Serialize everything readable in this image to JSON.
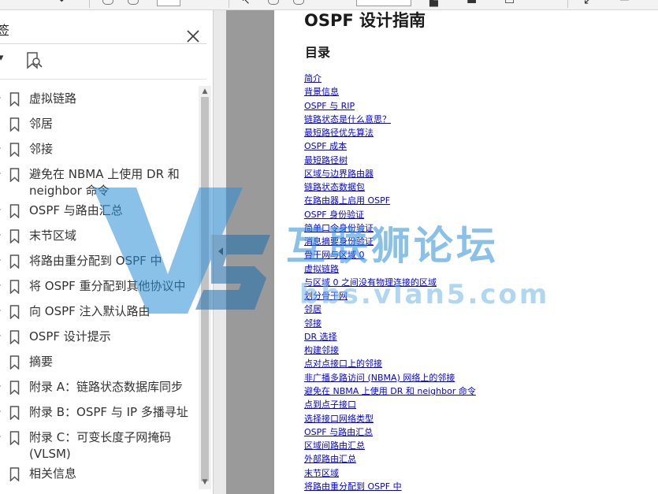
{
  "panel": {
    "title": "签",
    "options_label": "I▾",
    "bookmarks": [
      {
        "label": "虚拟链路",
        "expandable": true
      },
      {
        "label": "邻居",
        "expandable": false
      },
      {
        "label": "邻接",
        "expandable": true
      },
      {
        "label": "避免在 NBMA 上使用 DR 和 neighbor 命令",
        "expandable": true
      },
      {
        "label": "OSPF 与路由汇总",
        "expandable": true
      },
      {
        "label": "末节区域",
        "expandable": true
      },
      {
        "label": "将路由重分配到 OSPF 中",
        "expandable": true
      },
      {
        "label": "将 OSPF 重分配到其他协议中",
        "expandable": true
      },
      {
        "label": "向 OSPF 注入默认路由",
        "expandable": true
      },
      {
        "label": "OSPF 设计提示",
        "expandable": true
      },
      {
        "label": "摘要",
        "expandable": false
      },
      {
        "label": "附录 A：链路状态数据库同步",
        "expandable": true
      },
      {
        "label": "附录 B：OSPF 与 IP 多播寻址",
        "expandable": true
      },
      {
        "label": "附录 C：可变长度子网掩码 (VLSM)",
        "expandable": true
      },
      {
        "label": "相关信息",
        "expandable": false
      }
    ]
  },
  "document": {
    "title": "OSPF 设计指南",
    "toc_heading": "目录",
    "toc": [
      "简介",
      "背景信息",
      "OSPF 与 RIP",
      "链路状态是什么意思？",
      "最短路径优先算法",
      "OSPF 成本",
      "最短路径树",
      "区域与边界路由器",
      "链路状态数据包",
      "在路由器上启用 OSPF",
      "OSPF 身份验证",
      "简单口令身份验证",
      "消息摘要身份验证",
      "骨干网与区域 0",
      "虚拟链路",
      "与区域 0 之间没有物理连接的区域",
      "划分骨干网",
      "邻居",
      "邻接",
      "DR 选择",
      "构建邻接",
      "点对点接口上的邻接",
      "非广播多路访问 (NBMA) 网络上的邻接",
      "避免在 NBMA 上使用 DR 和 neighbor 命令",
      "点到点子接口",
      "选择接口网络类型",
      "OSPF 与路由汇总",
      "区域间路由汇总",
      "外部路由汇总",
      "末节区域",
      "将路由重分配到 OSPF 中"
    ]
  },
  "watermark": {
    "logo": "V5",
    "name": "互联狮论坛",
    "url": "bbs.vlan5.com"
  },
  "colors": {
    "link": "#0000ee",
    "gutter": "#9a9a9a",
    "watermark": "#2c8fd6"
  }
}
